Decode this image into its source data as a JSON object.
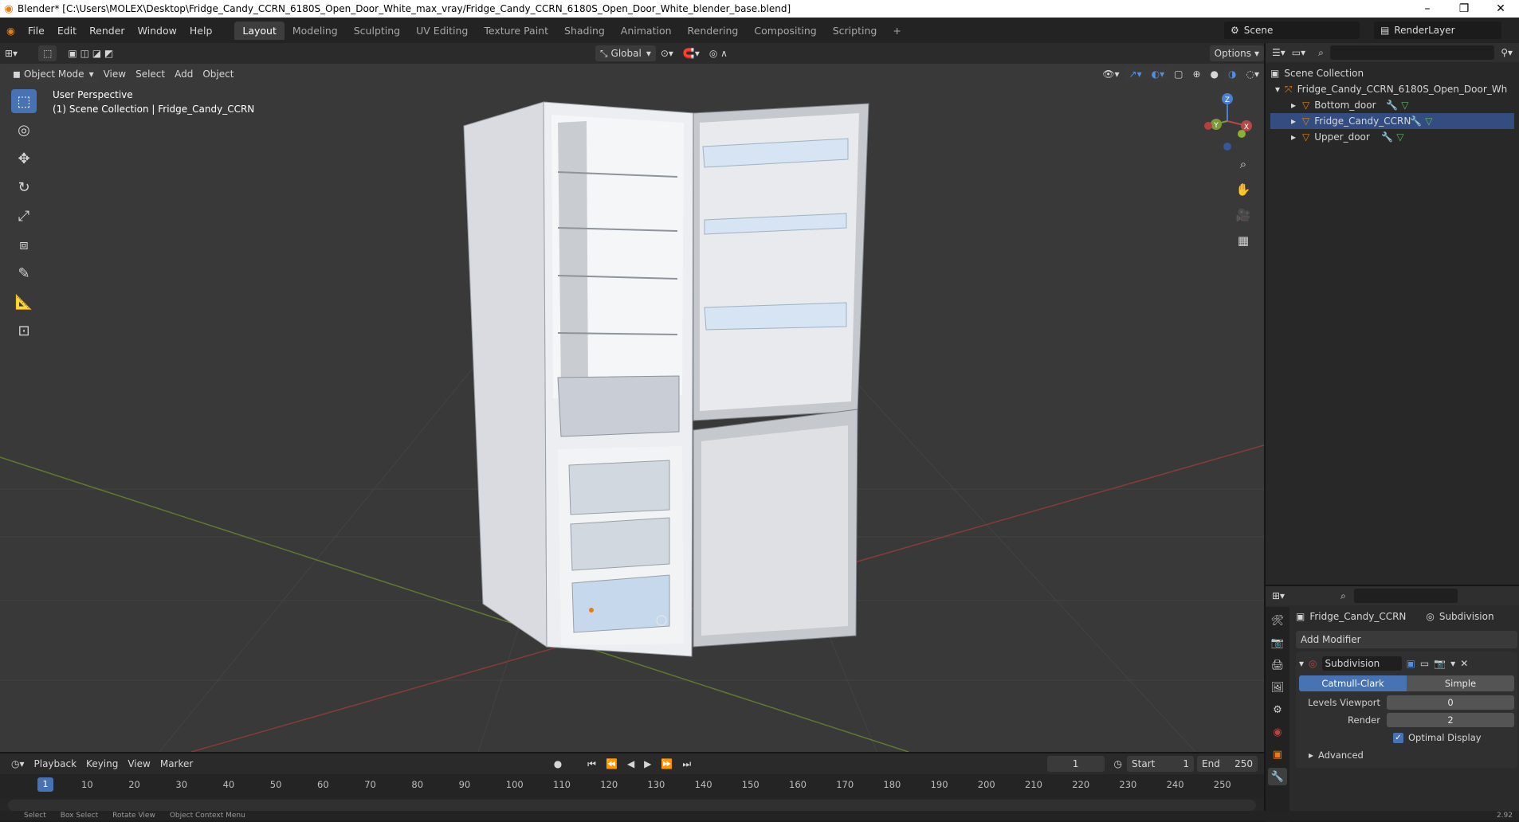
{
  "window": {
    "title": "Blender* [C:\\Users\\MOLEX\\Desktop\\Fridge_Candy_CCRN_6180S_Open_Door_White_max_vray/Fridge_Candy_CCRN_6180S_Open_Door_White_blender_base.blend]",
    "minimize": "–",
    "restore": "❐",
    "close": "✕"
  },
  "menus": [
    "File",
    "Edit",
    "Render",
    "Window",
    "Help"
  ],
  "workspaces": [
    "Layout",
    "Modeling",
    "Sculpting",
    "UV Editing",
    "Texture Paint",
    "Shading",
    "Animation",
    "Rendering",
    "Compositing",
    "Scripting"
  ],
  "active_workspace": "Layout",
  "add_workspace": "+",
  "scene": {
    "name": "Scene",
    "render_layer": "RenderLayer"
  },
  "viewport_header": {
    "transform_orientation": "Global",
    "options": "Options",
    "mode": "Object Mode",
    "menu": [
      "View",
      "Select",
      "Add",
      "Object"
    ]
  },
  "viewport_overlay": {
    "perspective": "User Perspective",
    "collection_info": "(1) Scene Collection | Fridge_Candy_CCRN"
  },
  "gizmo": {
    "x": "X",
    "y": "Y",
    "z": "Z"
  },
  "outliner": {
    "root": "Scene Collection",
    "collection": "Fridge_Candy_CCRN_6180S_Open_Door_Wh",
    "objects": [
      "Bottom_door",
      "Fridge_Candy_CCRN",
      "Upper_door"
    ]
  },
  "properties": {
    "object_name": "Fridge_Candy_CCRN",
    "modifier_tab": "Subdivision",
    "add_modifier": "Add Modifier",
    "modifier": {
      "name": "Subdivision",
      "mode_catmull": "Catmull-Clark",
      "mode_simple": "Simple",
      "levels_viewport_label": "Levels Viewport",
      "levels_viewport": "0",
      "render_label": "Render",
      "render": "2",
      "optimal_display": "Optimal Display",
      "advanced": "Advanced"
    }
  },
  "timeline": {
    "menu": [
      "Playback",
      "Keying",
      "View",
      "Marker"
    ],
    "current_frame": "1",
    "start_label": "Start",
    "start": "1",
    "end_label": "End",
    "end": "250",
    "ruler": [
      "10",
      "20",
      "30",
      "40",
      "50",
      "60",
      "70",
      "80",
      "90",
      "100",
      "110",
      "120",
      "130",
      "140",
      "150",
      "160",
      "170",
      "180",
      "190",
      "200",
      "210",
      "220",
      "230",
      "240",
      "250"
    ],
    "playhead": "1"
  },
  "status": {
    "select": "Select",
    "box_select": "Box Select",
    "rotate": "Rotate View",
    "context": "Object Context Menu",
    "version": "2.92"
  },
  "colors": {
    "accent": "#4772b3",
    "x_axis": "#b34a4a",
    "y_axis": "#7a9a3a",
    "z_axis": "#4a7fd1",
    "origin": "#e87d0d"
  }
}
